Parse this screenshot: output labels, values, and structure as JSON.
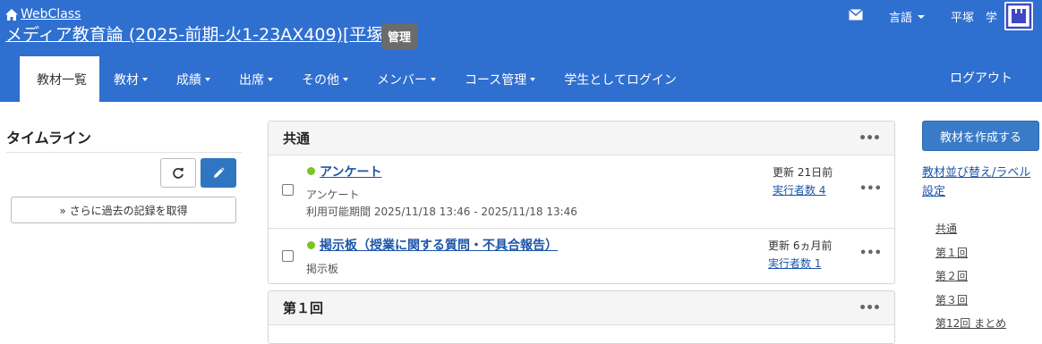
{
  "header": {
    "brand": "WebClass",
    "course_title": "メディア教育論 (2025-前期-火1-23AX409)[平塚]",
    "admin_badge": "管理",
    "language_label": "言語",
    "user_name": "平塚　学",
    "logout": "ログアウト",
    "bg_color": "#2f6fd0"
  },
  "nav": {
    "items": [
      {
        "label": "教材一覧",
        "dropdown": false,
        "active": true
      },
      {
        "label": "教材",
        "dropdown": true
      },
      {
        "label": "成績",
        "dropdown": true
      },
      {
        "label": "出席",
        "dropdown": true
      },
      {
        "label": "その他",
        "dropdown": true
      },
      {
        "label": "メンバー",
        "dropdown": true
      },
      {
        "label": "コース管理",
        "dropdown": true
      },
      {
        "label": "学生としてログイン",
        "dropdown": false
      }
    ]
  },
  "timeline": {
    "title": "タイムライン",
    "more_history": "» さらに過去の記録を取得",
    "icons": [
      "refresh-icon",
      "pencil-icon"
    ]
  },
  "sections": [
    {
      "title": "共通",
      "menu": "•••",
      "items": [
        {
          "title": "アンケート",
          "type": "アンケート",
          "period": "利用可能期間 2025/11/18 13:46 - 2025/11/18 13:46",
          "updated": "更新 21日前",
          "executions": "実行者数 4",
          "menu": "•••"
        },
        {
          "title": "掲示板（授業に関する質問・不具合報告）",
          "type": "掲示板",
          "updated": "更新 6ヵ月前",
          "executions": "実行者数 1",
          "menu": "•••"
        }
      ]
    },
    {
      "title": "第１回",
      "menu": "•••"
    }
  ],
  "sidebar": {
    "create_button": "教材を作成する",
    "sort_link": "教材並び替え/ラベル設定",
    "toc": [
      "共通",
      "第１回",
      "第２回",
      "第３回",
      "第12回 まとめ"
    ]
  },
  "colors": {
    "accent": "#2f6fd0",
    "link": "#1c56a8",
    "status_active": "#7cc227"
  }
}
